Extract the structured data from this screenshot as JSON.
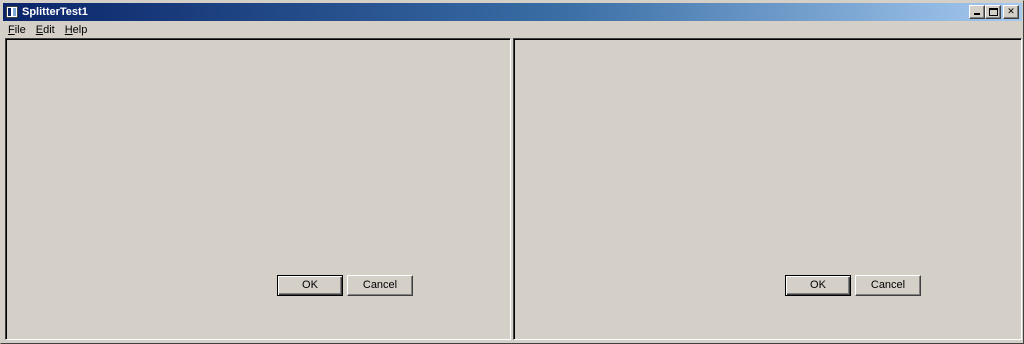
{
  "window": {
    "title": "SplitterTest1"
  },
  "menubar": {
    "items": [
      {
        "accel": "F",
        "rest": "ile"
      },
      {
        "accel": "E",
        "rest": "dit"
      },
      {
        "accel": "H",
        "rest": "elp"
      }
    ]
  },
  "panes": [
    {
      "ok_label": "OK",
      "cancel_label": "Cancel"
    },
    {
      "ok_label": "OK",
      "cancel_label": "Cancel"
    }
  ],
  "colors": {
    "face": "#d4d0c8",
    "title_start": "#0a246a",
    "title_end": "#a6caf0",
    "title_text": "#ffffff"
  },
  "icons": {
    "app": "app-window-icon",
    "minimize": "minimize-icon",
    "maximize": "maximize-icon",
    "close": "close-icon"
  }
}
